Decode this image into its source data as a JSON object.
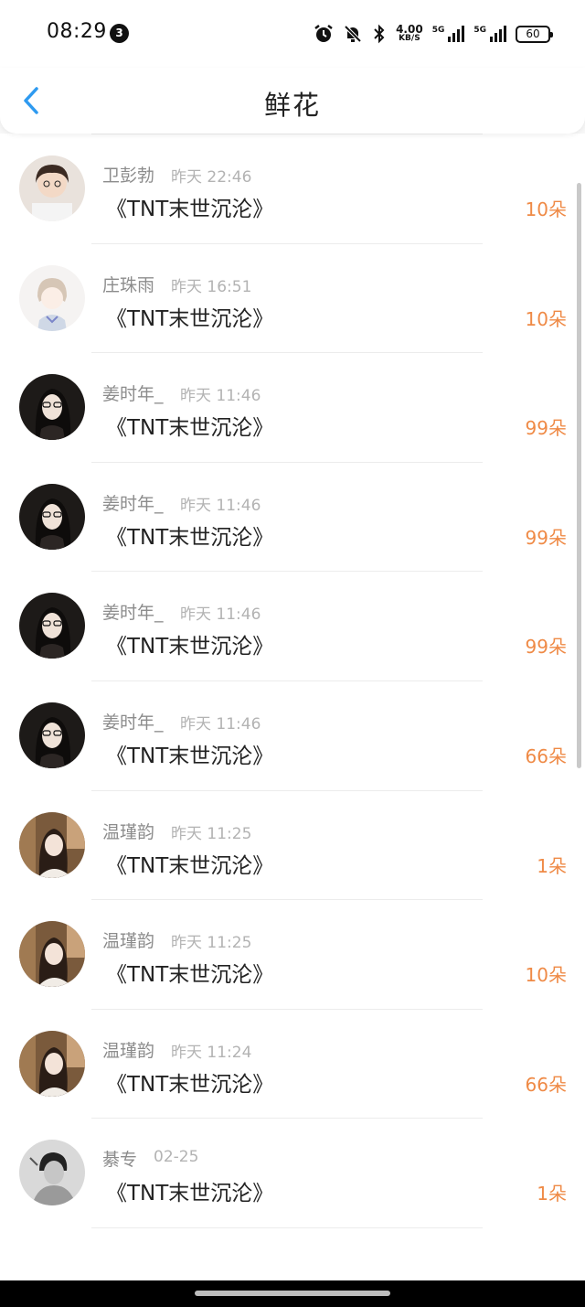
{
  "status_bar": {
    "time": "08:29",
    "notification_count": "3",
    "net_speed_value": "4.00",
    "net_speed_unit": "KB/S",
    "sig1_label": "5G",
    "sig2_label": "5G",
    "battery": "60"
  },
  "header": {
    "title": "鲜花",
    "back_icon": "chevron-left-icon"
  },
  "colors": {
    "accent_blue": "#2e9af0",
    "count_orange": "#ef8a46"
  },
  "rows": [
    {
      "user": "卫彭勃",
      "time": "昨天 22:46",
      "book": "《TNT末世沉沦》",
      "count": "10朵",
      "avatar": "avatar-1"
    },
    {
      "user": "庄珠雨",
      "time": "昨天 16:51",
      "book": "《TNT末世沉沦》",
      "count": "10朵",
      "avatar": "avatar-2"
    },
    {
      "user": "姜时年_",
      "time": "昨天 11:46",
      "book": "《TNT末世沉沦》",
      "count": "99朵",
      "avatar": "avatar-3"
    },
    {
      "user": "姜时年_",
      "time": "昨天 11:46",
      "book": "《TNT末世沉沦》",
      "count": "99朵",
      "avatar": "avatar-3"
    },
    {
      "user": "姜时年_",
      "time": "昨天 11:46",
      "book": "《TNT末世沉沦》",
      "count": "99朵",
      "avatar": "avatar-3"
    },
    {
      "user": "姜时年_",
      "time": "昨天 11:46",
      "book": "《TNT末世沉沦》",
      "count": "66朵",
      "avatar": "avatar-3"
    },
    {
      "user": "温瑾韵",
      "time": "昨天 11:25",
      "book": "《TNT末世沉沦》",
      "count": "1朵",
      "avatar": "avatar-4"
    },
    {
      "user": "温瑾韵",
      "time": "昨天 11:25",
      "book": "《TNT末世沉沦》",
      "count": "10朵",
      "avatar": "avatar-4"
    },
    {
      "user": "温瑾韵",
      "time": "昨天 11:24",
      "book": "《TNT末世沉沦》",
      "count": "66朵",
      "avatar": "avatar-4"
    },
    {
      "user": "綦专",
      "time": "02-25",
      "book": "《TNT末世沉沦》",
      "count": "1朵",
      "avatar": "avatar-5"
    }
  ]
}
